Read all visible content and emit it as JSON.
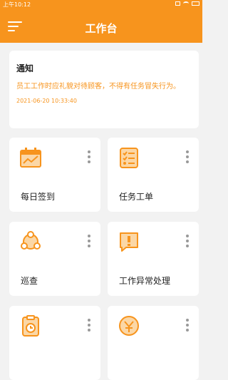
{
  "status_bar": {
    "time": "上午10:12"
  },
  "header": {
    "title": "工作台"
  },
  "notice": {
    "title": "通知",
    "body": "员工工作时应礼貌对待顾客，不得有任务冒失行为。",
    "time": "2021-06-20 10:33:40"
  },
  "tiles": [
    {
      "label": "每日签到",
      "icon": "calendar-icon"
    },
    {
      "label": "任务工单",
      "icon": "checklist-icon"
    },
    {
      "label": "巡查",
      "icon": "patrol-icon"
    },
    {
      "label": "工作异常处理",
      "icon": "alert-icon"
    },
    {
      "label": "",
      "icon": "clipboard-icon"
    },
    {
      "label": "",
      "icon": "shield-icon"
    }
  ],
  "colors": {
    "accent": "#f7941d",
    "background": "#f2f2f2"
  }
}
